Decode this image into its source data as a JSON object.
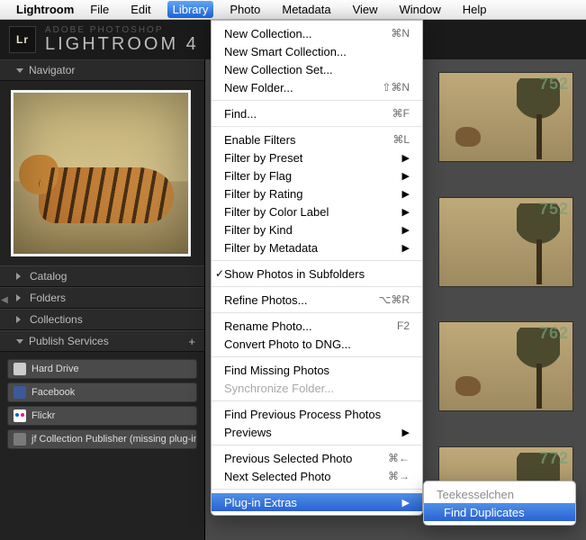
{
  "menubar": {
    "app": "Lightroom",
    "items": [
      "File",
      "Edit",
      "Library",
      "Photo",
      "Metadata",
      "View",
      "Window",
      "Help"
    ],
    "active": "Library"
  },
  "header": {
    "badge": "Lr",
    "line1": "ADOBE PHOTOSHOP",
    "line2": "LIGHTROOM 4"
  },
  "sidebar": {
    "panels": {
      "navigator": "Navigator",
      "catalog": "Catalog",
      "folders": "Folders",
      "collections": "Collections",
      "publish": "Publish Services"
    },
    "publish_items": [
      {
        "key": "hd",
        "label": "Hard Drive"
      },
      {
        "key": "fb",
        "label": "Facebook"
      },
      {
        "key": "fl",
        "label": "Flickr"
      },
      {
        "key": "jf",
        "label": "jf Collection Publisher (missing plug-in) : i…"
      }
    ],
    "publish_plus": "+"
  },
  "thumbs": {
    "watermark1": "752",
    "watermark2": "752",
    "watermark3": "762",
    "watermark4": "772"
  },
  "menu": {
    "groups": [
      [
        {
          "label": "New Collection...",
          "shortcut": "⌘N"
        },
        {
          "label": "New Smart Collection..."
        },
        {
          "label": "New Collection Set..."
        },
        {
          "label": "New Folder...",
          "shortcut": "⇧⌘N"
        }
      ],
      [
        {
          "label": "Find...",
          "shortcut": "⌘F"
        }
      ],
      [
        {
          "label": "Enable Filters",
          "shortcut": "⌘L"
        },
        {
          "label": "Filter by Preset",
          "submenu": true
        },
        {
          "label": "Filter by Flag",
          "submenu": true
        },
        {
          "label": "Filter by Rating",
          "submenu": true
        },
        {
          "label": "Filter by Color Label",
          "submenu": true
        },
        {
          "label": "Filter by Kind",
          "submenu": true
        },
        {
          "label": "Filter by Metadata",
          "submenu": true
        }
      ],
      [
        {
          "label": "Show Photos in Subfolders",
          "checked": true
        }
      ],
      [
        {
          "label": "Refine Photos...",
          "shortcut": "⌥⌘R"
        }
      ],
      [
        {
          "label": "Rename Photo...",
          "shortcut": "F2"
        },
        {
          "label": "Convert Photo to DNG..."
        }
      ],
      [
        {
          "label": "Find Missing Photos"
        },
        {
          "label": "Synchronize Folder...",
          "disabled": true
        }
      ],
      [
        {
          "label": "Find Previous Process Photos"
        },
        {
          "label": "Previews",
          "submenu": true
        }
      ],
      [
        {
          "label": "Previous Selected Photo",
          "shortcut": "⌘←"
        },
        {
          "label": "Next Selected Photo",
          "shortcut": "⌘→"
        }
      ],
      [
        {
          "label": "Plug-in Extras",
          "submenu": true,
          "hover": true
        }
      ]
    ]
  },
  "submenu": {
    "header": "Teekesselchen",
    "item": "Find Duplicates"
  }
}
